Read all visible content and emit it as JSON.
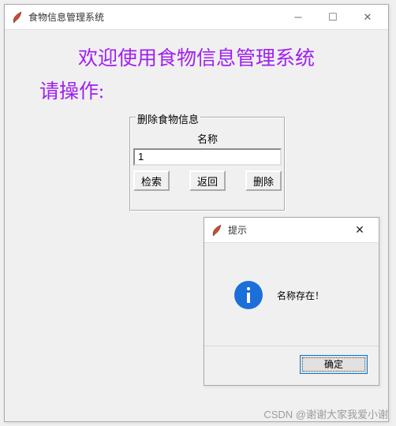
{
  "main_window": {
    "title": "食物信息管理系统",
    "welcome": "欢迎使用食物信息管理系统",
    "prompt": "请操作:"
  },
  "groupbox": {
    "legend": "删除食物信息",
    "label_name": "名称",
    "input_value": "1",
    "buttons": {
      "search": "检索",
      "back": "返回",
      "delete": "删除"
    }
  },
  "dialog": {
    "title": "提示",
    "message": "名称存在！",
    "ok": "确定"
  },
  "watermark": "CSDN @谢谢大家我爱小谢"
}
